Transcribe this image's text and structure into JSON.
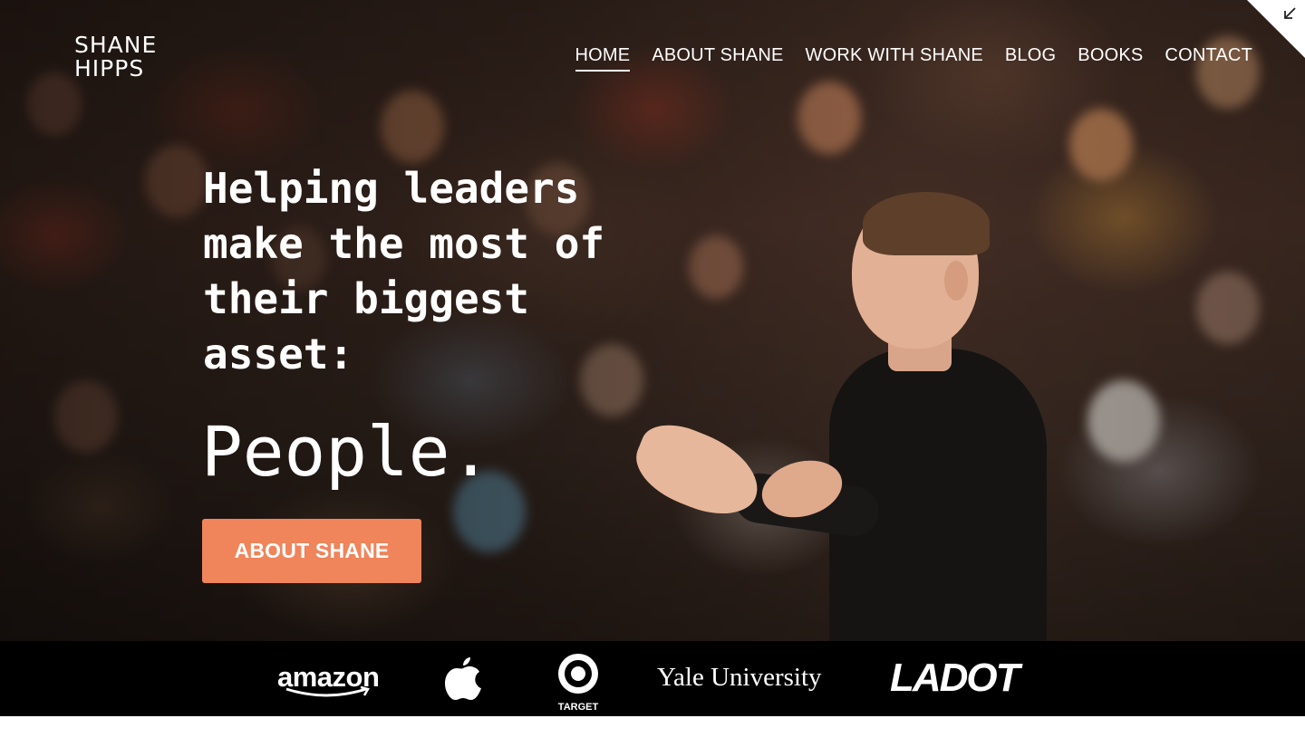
{
  "brand": {
    "line1": "SHANE",
    "line2": "HIPPS"
  },
  "nav": {
    "items": [
      {
        "label": "HOME",
        "active": true
      },
      {
        "label": "ABOUT SHANE",
        "active": false
      },
      {
        "label": "WORK WITH SHANE",
        "active": false
      },
      {
        "label": "BLOG",
        "active": false
      },
      {
        "label": "BOOKS",
        "active": false
      },
      {
        "label": "CONTACT",
        "active": false
      }
    ]
  },
  "corner": {
    "icon": "collapse-arrow-icon"
  },
  "hero": {
    "headline_lines": [
      "Helping leaders",
      "make the most of",
      "their biggest",
      "asset:"
    ],
    "headline_emphasis": "People.",
    "cta_label": "ABOUT SHANE",
    "cta_color": "#f0845a"
  },
  "client_logos": {
    "amazon": "amazon",
    "apple": "apple-logo-icon",
    "target": "TARGET",
    "yale": "Yale University",
    "ladot": "LADOT"
  }
}
